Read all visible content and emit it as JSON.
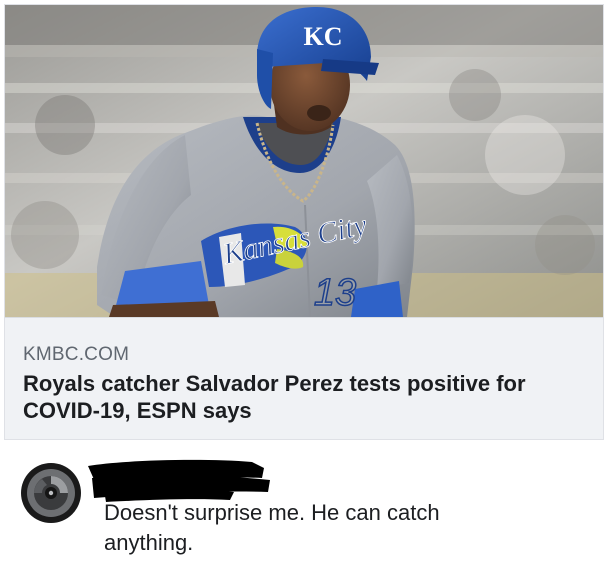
{
  "link_preview": {
    "image_alt": "Baseball player in Royals uniform and blue KC helmet running",
    "helmet_logo": "KC",
    "jersey_script": "Kansas City",
    "jersey_number": "13",
    "domain": "KMBC.COM",
    "headline": "Royals catcher Salvador Perez tests positive for COVID-19, ESPN says"
  },
  "comment": {
    "avatar_icon": "avatar-icon",
    "author_redacted": true,
    "text": "Doesn't surprise me.  He can catch anything."
  },
  "colors": {
    "royals_blue": "#1f4fa8",
    "uniform_gray": "#a7acb3",
    "card_bg": "#f0f2f5",
    "domain_text": "#606770",
    "headline_text": "#1c1e21"
  }
}
